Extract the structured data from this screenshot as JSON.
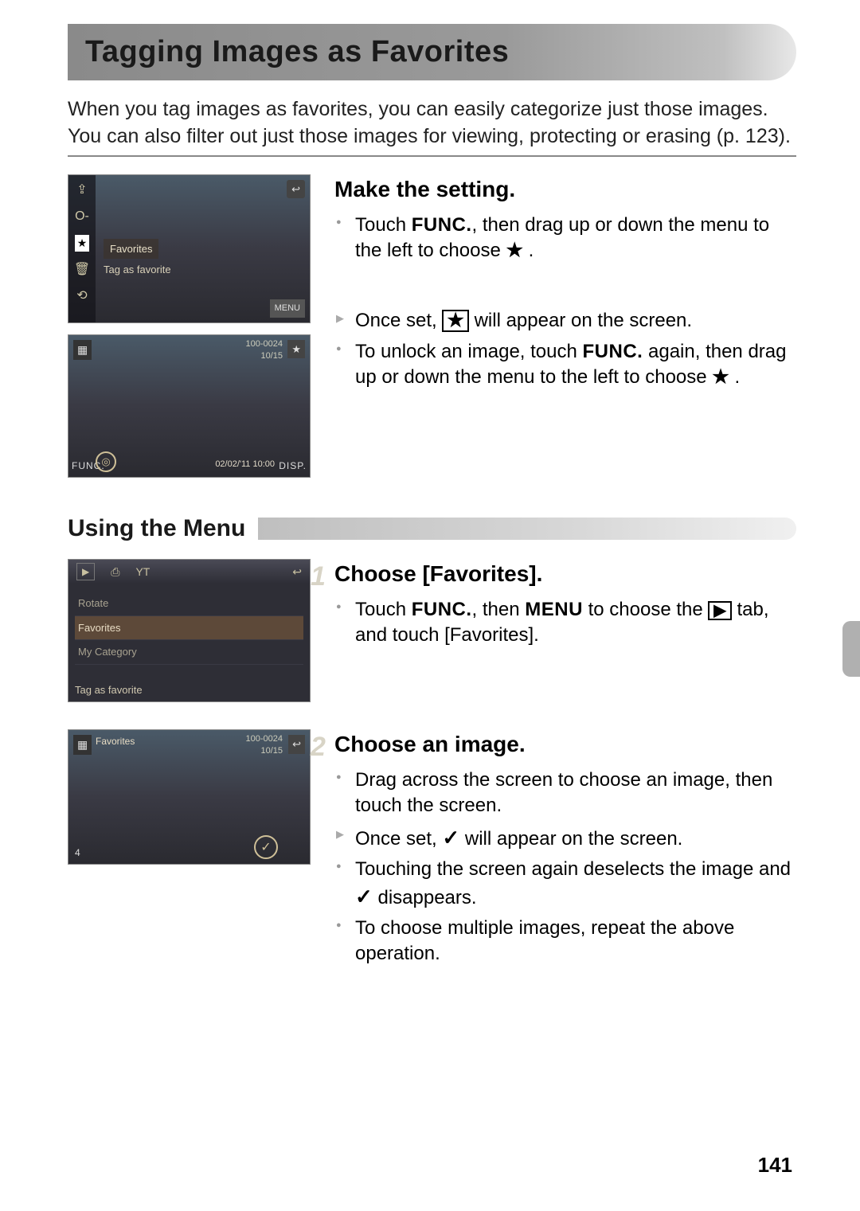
{
  "title": "Tagging Images as Favorites",
  "intro": "When you tag images as favorites, you can easily categorize just those images. You can also filter out just those images for viewing, protecting or erasing (p. 123).",
  "section1": {
    "heading": "Make the setting.",
    "b1a": "Touch ",
    "b1b": ", then drag up or down the menu to the left to choose ",
    "b1c": " .",
    "b2a": "Once set, ",
    "b2b": " will appear on the screen.",
    "b3a": "To unlock an image, touch ",
    "b3b": " again, then drag up or down the menu to the left to choose ",
    "b3c": " ."
  },
  "subheading": "Using the Menu",
  "step1": {
    "num": "1",
    "heading": "Choose [Favorites].",
    "b1a": "Touch ",
    "b1b": ", then ",
    "b1c": " to choose the ",
    "b1d": " tab, and touch [Favorites]."
  },
  "step2": {
    "num": "2",
    "heading": "Choose an image.",
    "b1": "Drag across the screen to choose an image, then touch the screen.",
    "b2a": "Once set, ",
    "b2b": " will appear on the screen.",
    "b3a": "Touching the screen again deselects the image and ",
    "b3b": " disappears.",
    "b4": "To choose multiple images, repeat the above operation."
  },
  "labels": {
    "func": "FUNC.",
    "menu": "MENU",
    "star": "★",
    "check": "✓",
    "play": "▶"
  },
  "screens": {
    "s1": {
      "fav": "Favorites",
      "tag": "Tag as favorite",
      "menu": "MENU",
      "om": "O‑"
    },
    "s2": {
      "info1": "100-0024",
      "info2": "10/15",
      "date": "02/02/'11   10:00",
      "func": "FUNC.",
      "disp": "DISP."
    },
    "s3": {
      "tab_yt": "YT",
      "rotate": "Rotate",
      "fav": "Favorites",
      "mycat": "My Category",
      "caption": "Tag as favorite"
    },
    "s4": {
      "title": "Favorites",
      "info1": "100-0024",
      "info2": "10/15",
      "count": "4"
    }
  },
  "page": "141"
}
